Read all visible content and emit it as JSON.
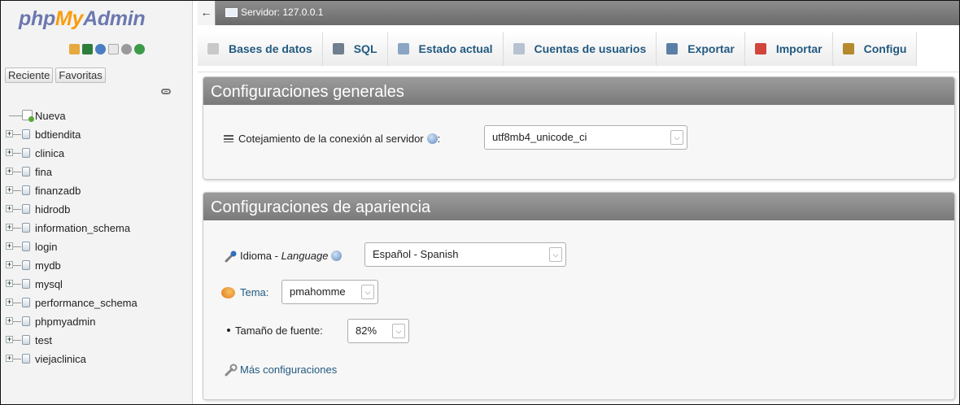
{
  "nav": {
    "logo": {
      "part1": "php",
      "part2": "My",
      "part3": "Admin"
    },
    "tabs": {
      "recent": "Reciente",
      "favorites": "Favoritas"
    },
    "tree": {
      "new_label": "Nueva",
      "databases": [
        "bdtiendita",
        "clinica",
        "fina",
        "finanzadb",
        "hidrodb",
        "information_schema",
        "login",
        "mydb",
        "mysql",
        "performance_schema",
        "phpmyadmin",
        "test",
        "viejaclinica"
      ]
    }
  },
  "header": {
    "back_symbol": "←",
    "server_label": "Servidor: 127.0.0.1"
  },
  "menu": {
    "tabs": [
      {
        "label": "Bases de datos",
        "icon": "database-icon"
      },
      {
        "label": "SQL",
        "icon": "sql-icon"
      },
      {
        "label": "Estado actual",
        "icon": "status-icon"
      },
      {
        "label": "Cuentas de usuarios",
        "icon": "users-icon"
      },
      {
        "label": "Exportar",
        "icon": "export-icon"
      },
      {
        "label": "Importar",
        "icon": "import-icon"
      },
      {
        "label": "Configu",
        "icon": "wrench-icon"
      }
    ]
  },
  "general": {
    "title": "Configuraciones generales",
    "collation_label": "Cotejamiento de la conexión al servidor",
    "collation_colon": ":",
    "collation_value": "utf8mb4_unicode_ci"
  },
  "appearance": {
    "title": "Configuraciones de apariencia",
    "language_label": "Idioma - ",
    "language_label_italic": "Language",
    "language_value": "Español - Spanish",
    "theme_label": "Tema:",
    "theme_value": "pmahomme",
    "font_size_label": "Tamaño de fuente:",
    "font_size_value": "82%",
    "more_settings": "Más configuraciones"
  },
  "colors": {
    "link": "#235a81",
    "logo_blue": "#6c78af",
    "logo_orange": "#f89c0e"
  }
}
